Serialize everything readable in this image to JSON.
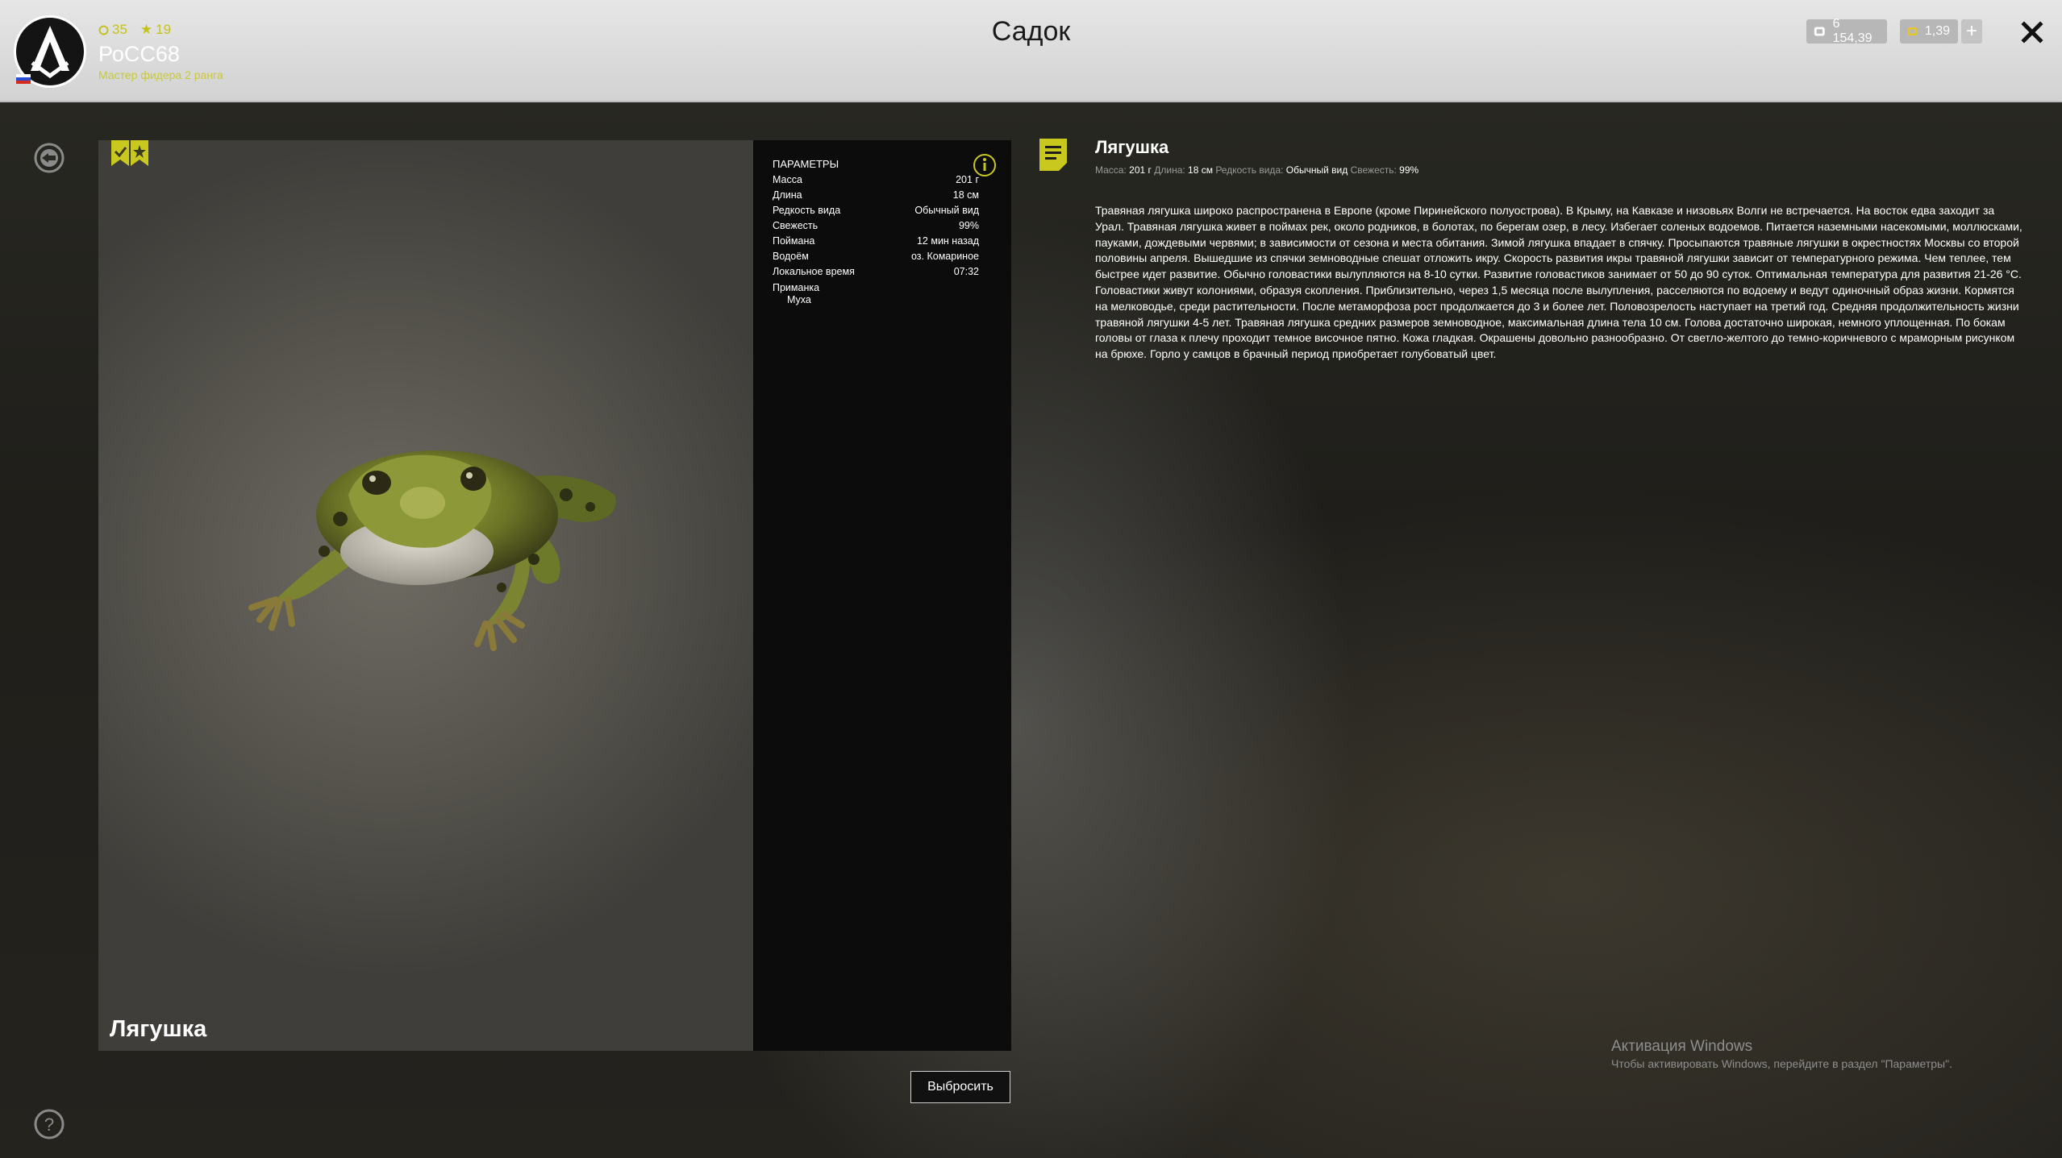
{
  "header": {
    "title": "Садок",
    "user": {
      "name": "РоСС68",
      "rank": "Мастер фидера 2 ранга",
      "level": "35",
      "stars": "19"
    },
    "currency": {
      "silver": "6 154,39",
      "gold": "1,39",
      "add_label": "+"
    },
    "close_label": "✕"
  },
  "viewer": {
    "fish_name": "Лягушка"
  },
  "params": {
    "title": "ПАРАМЕТРЫ",
    "rows": [
      {
        "label": "Масса",
        "value": "201 г"
      },
      {
        "label": "Длина",
        "value": "18 см"
      },
      {
        "label": "Редкость вида",
        "value": "Обычный вид"
      },
      {
        "label": "Свежесть",
        "value": "99%"
      },
      {
        "label": "Поймана",
        "value": "12 мин назад"
      },
      {
        "label": "Водоём",
        "value": "оз. Комариное"
      },
      {
        "label": "Локальное время",
        "value": "07:32"
      }
    ],
    "bait_label": "Приманка",
    "bait_value": "Муха",
    "discard_label": "Выбросить"
  },
  "description": {
    "title": "Лягушка",
    "meta": {
      "mass_label": "Масса:",
      "mass": "201 г",
      "length_label": "Длина:",
      "length": "18 см",
      "rarity_label": "Редкость вида:",
      "rarity": "Обычный вид",
      "fresh_label": "Свежесть:",
      "fresh": "99%"
    },
    "text": "Травяная лягушка широко распространена в Европе (кроме Пиринейского полуострова). В Крыму, на Кавказе и низовьях Волги не встречается. На восток едва заходит за Урал. Травяная лягушка живет в поймах рек, около родников, в болотах, по берегам озер, в лесу. Избегает соленых водоемов. Питается наземными насекомыми, моллюсками, пауками, дождевыми червями; в зависимости от сезона и места обитания. Зимой лягушка впадает в спячку. Просыпаются травяные лягушки в окрестностях Москвы со второй половины апреля. Вышедшие из спячки земноводные спешат отложить икру. Скорость развития икры травяной лягушки зависит от температурного режима. Чем теплее, тем быстрее идет развитие. Обычно головастики вылупляются на 8-10 сутки. Развитие головастиков занимает от 50 до 90 суток. Оптимальная температура для развития 21-26 °С. Головастики живут колониями, образуя скопления. Приблизительно, через 1,5 месяца после вылупления, расселяются по водоему и ведут одиночный образ жизни. Кормятся на мелководье, среди растительности. После метаморфоза рост продолжается до 3 и более лет. Половозрелость наступает на третий год. Средняя продолжительность жизни травяной лягушки 4-5 лет. Травяная лягушка средних размеров земноводное, максимальная длина тела 10 см. Голова достаточно широкая, немного уплощенная. По бокам головы от глаза к плечу проходит темное височное пятно. Кожа гладкая. Окрашены довольно разнообразно. От светло-желтого до темно-коричневого с мраморным рисунком на брюхе. Горло у самцов в брачный период приобретает голубоватый цвет."
  },
  "windows_activation": {
    "title": "Активация Windows",
    "subtitle": "Чтобы активировать Windows, перейдите в раздел \"Параметры\"."
  },
  "colors": {
    "accent": "#c8c81e",
    "topbar": "#d9d9d9",
    "params_bg": "#0c0c0c"
  },
  "icons": {
    "back": "back-arrow-icon",
    "help": "question-icon",
    "info": "info-icon",
    "close": "close-icon",
    "description": "document-icon"
  }
}
